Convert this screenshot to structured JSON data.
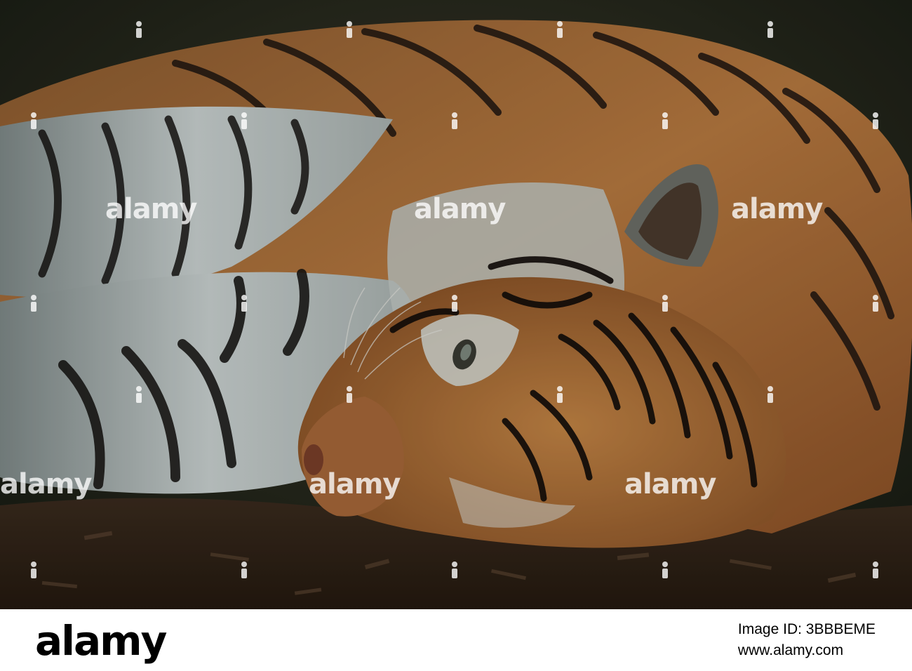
{
  "photo": {
    "subject": "tiger-lying-down",
    "watermark_text": "alamy"
  },
  "footer": {
    "brand": "alamy",
    "image_id_label": "Image ID: 3BBBEME",
    "site": "www.alamy.com"
  },
  "colors": {
    "fur_orange": "#b5743a",
    "fur_white": "#c9d0cf",
    "stripe": "#1c1410",
    "ground": "#3a2a1d",
    "background_dark": "#232a1e"
  }
}
